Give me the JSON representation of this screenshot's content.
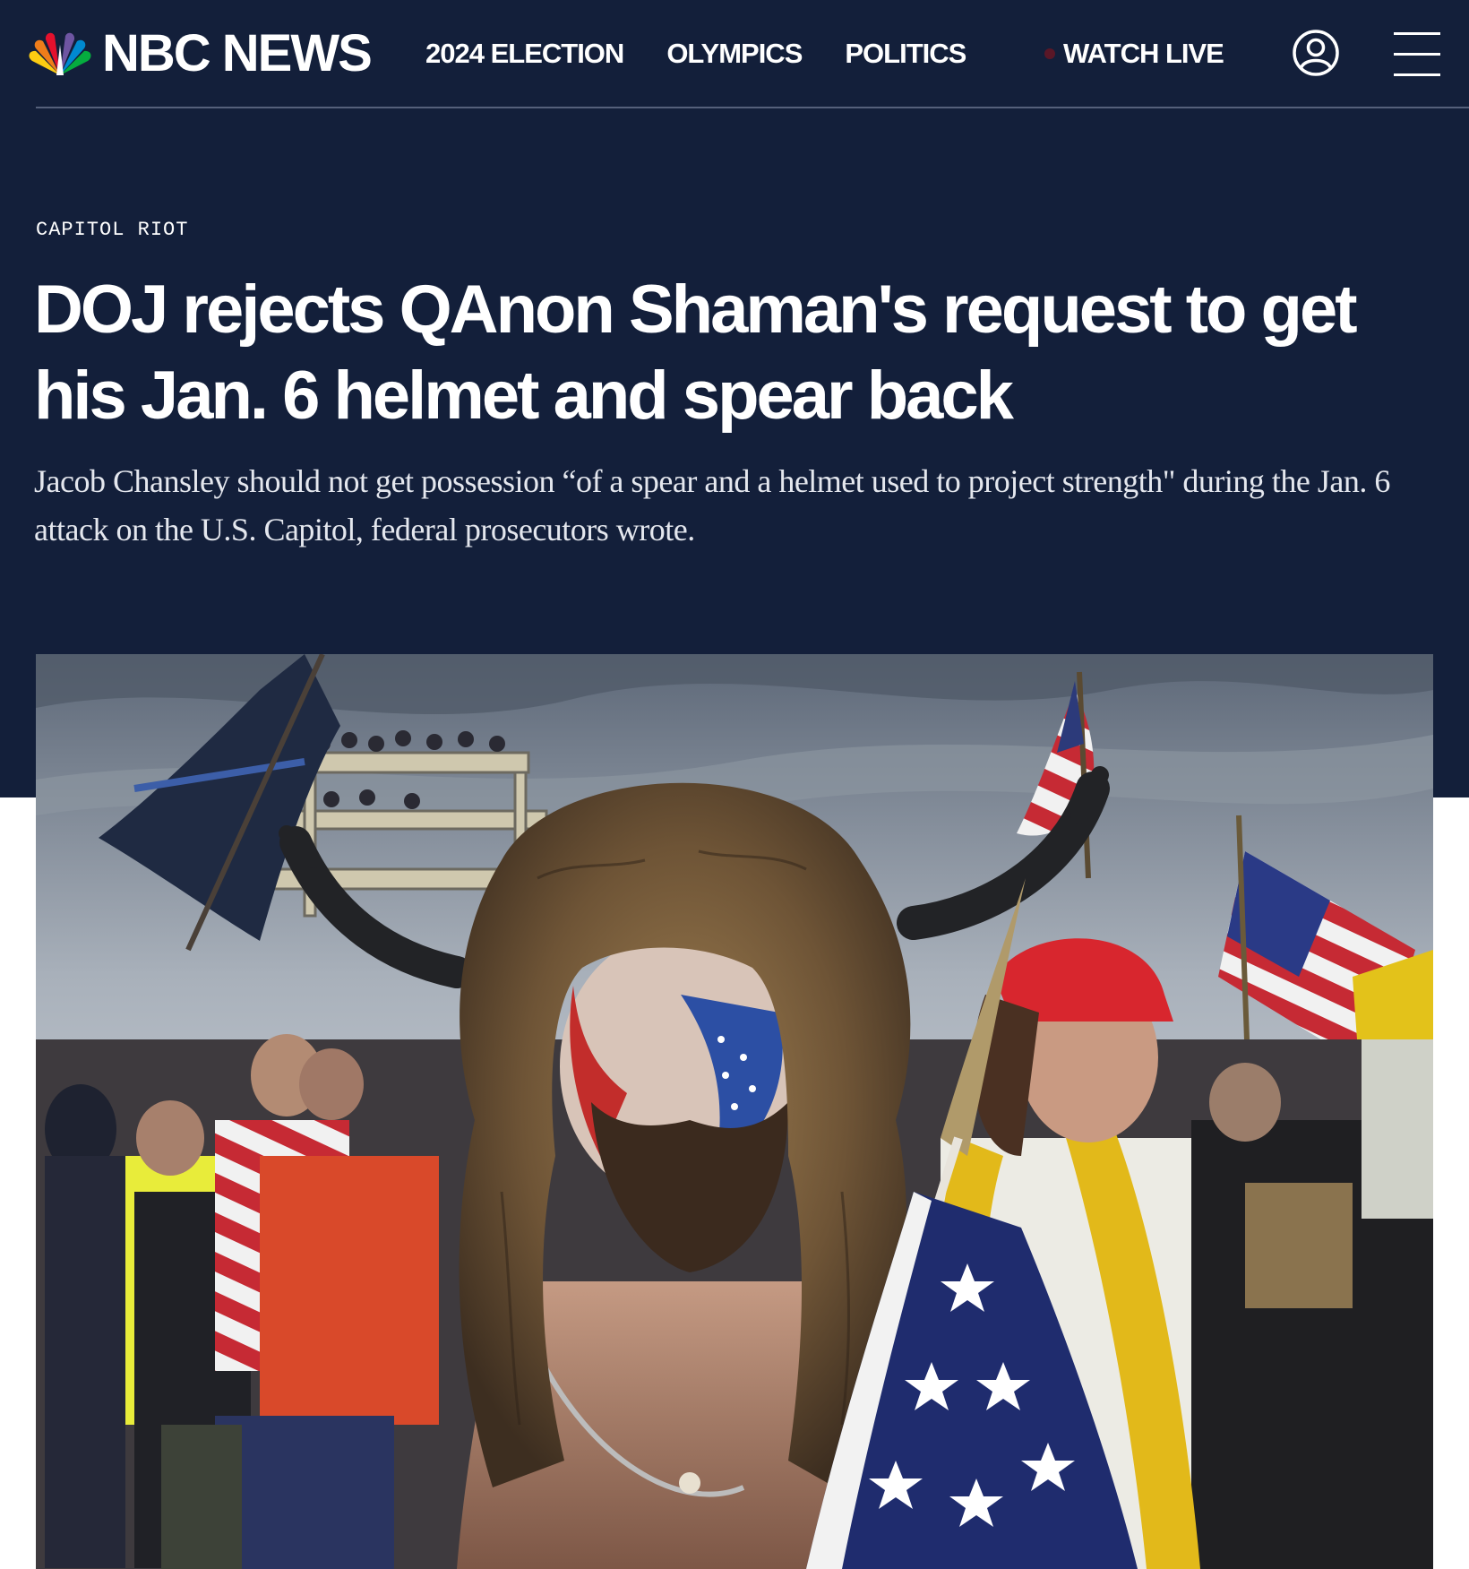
{
  "site": {
    "brand": "NBC NEWS",
    "logo_icon": "nbc-peacock-icon"
  },
  "nav": {
    "items": [
      "2024 ELECTION",
      "OLYMPICS",
      "POLITICS"
    ],
    "watch_live": "WATCH LIVE",
    "account_icon": "user-account-icon",
    "menu_icon": "hamburger-menu-icon"
  },
  "article": {
    "kicker": "CAPITOL RIOT",
    "headline": "DOJ rejects QAnon Shaman's request to get his Jan. 6 helmet and spear back",
    "dek": "Jacob Chansley should not get possession “of a spear and a helmet used to project strength\" during the Jan. 6 attack on the U.S. Capitol, federal prosecutors wrote."
  },
  "colors": {
    "header_background": "#131f3a",
    "live_dot": "#5a1727",
    "text_primary": "#ffffff"
  }
}
